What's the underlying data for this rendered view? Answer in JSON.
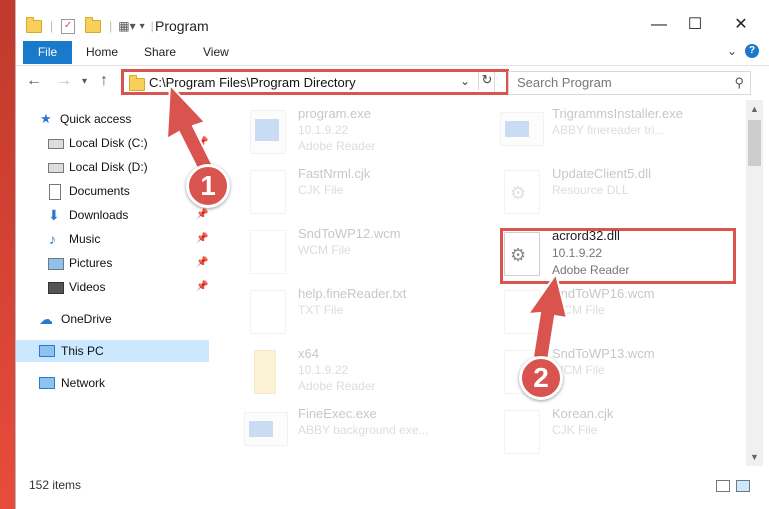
{
  "window": {
    "title": "Program",
    "minimize_glyph": "—",
    "maximize_glyph": "☐",
    "close_glyph": "✕"
  },
  "ribbon": {
    "tabs": [
      {
        "label": "File",
        "active": true
      },
      {
        "label": "Home"
      },
      {
        "label": "Share"
      },
      {
        "label": "View"
      }
    ],
    "help_glyph": "?"
  },
  "address": {
    "path": "C:\\Program Files\\Program Directory",
    "search_placeholder": "Search Program"
  },
  "nav": {
    "items": [
      {
        "label": "Quick access",
        "icon": "star-icon",
        "pinned": false
      },
      {
        "label": "Local Disk (C:)",
        "icon": "drive-icon",
        "pinned": true
      },
      {
        "label": "Local Disk (D:)",
        "icon": "drive-icon",
        "pinned": false
      },
      {
        "label": "Documents",
        "icon": "documents-icon",
        "pinned": false
      },
      {
        "label": "Downloads",
        "icon": "download-icon",
        "pinned": true
      },
      {
        "label": "Music",
        "icon": "music-icon",
        "pinned": true
      },
      {
        "label": "Pictures",
        "icon": "pictures-icon",
        "pinned": true
      },
      {
        "label": "Videos",
        "icon": "videos-icon",
        "pinned": true
      },
      {
        "label": "OneDrive",
        "icon": "cloud-icon",
        "pinned": false
      },
      {
        "label": "This PC",
        "icon": "computer-icon",
        "pinned": false,
        "selected": true
      },
      {
        "label": "Network",
        "icon": "network-icon",
        "pinned": false
      }
    ]
  },
  "files": {
    "left": [
      {
        "name": "program.exe",
        "line1": "10.1.9.22",
        "line2": "Adobe Reader",
        "type": "exe"
      },
      {
        "name": "FastNrml.cjk",
        "line1": "CJK File",
        "line2": "",
        "type": "doc"
      },
      {
        "name": "SndToWP12.wcm",
        "line1": "WCM File",
        "line2": "",
        "type": "doc"
      },
      {
        "name": "help.fineReader.txt",
        "line1": "TXT File",
        "line2": "",
        "type": "doc"
      },
      {
        "name": "x64",
        "line1": "10.1.9.22",
        "line2": "Adobe Reader",
        "type": "folder"
      },
      {
        "name": "FineExec.exe",
        "line1": "ABBY background exe...",
        "line2": "",
        "type": "exe"
      }
    ],
    "right": [
      {
        "name": "TrigrammsInstaller.exe",
        "line1": "ABBY finereader tri...",
        "line2": "",
        "type": "exe"
      },
      {
        "name": "UpdateClient5.dll",
        "line1": "Resource DLL",
        "line2": "",
        "type": "dll"
      },
      {
        "name": "acrord32.dll",
        "line1": "10.1.9.22",
        "line2": "Adobe Reader",
        "type": "dll",
        "highlighted": true
      },
      {
        "name": "SndToWP16.wcm",
        "line1": "WCM File",
        "line2": "",
        "type": "doc"
      },
      {
        "name": "SndToWP13.wcm",
        "line1": "WCM File",
        "line2": "",
        "type": "doc"
      },
      {
        "name": "Korean.cjk",
        "line1": "CJK File",
        "line2": "",
        "type": "doc"
      }
    ]
  },
  "status": {
    "item_count": "152 items"
  },
  "annotations": {
    "callout1": "1",
    "callout2": "2",
    "color": "#d9534f"
  }
}
